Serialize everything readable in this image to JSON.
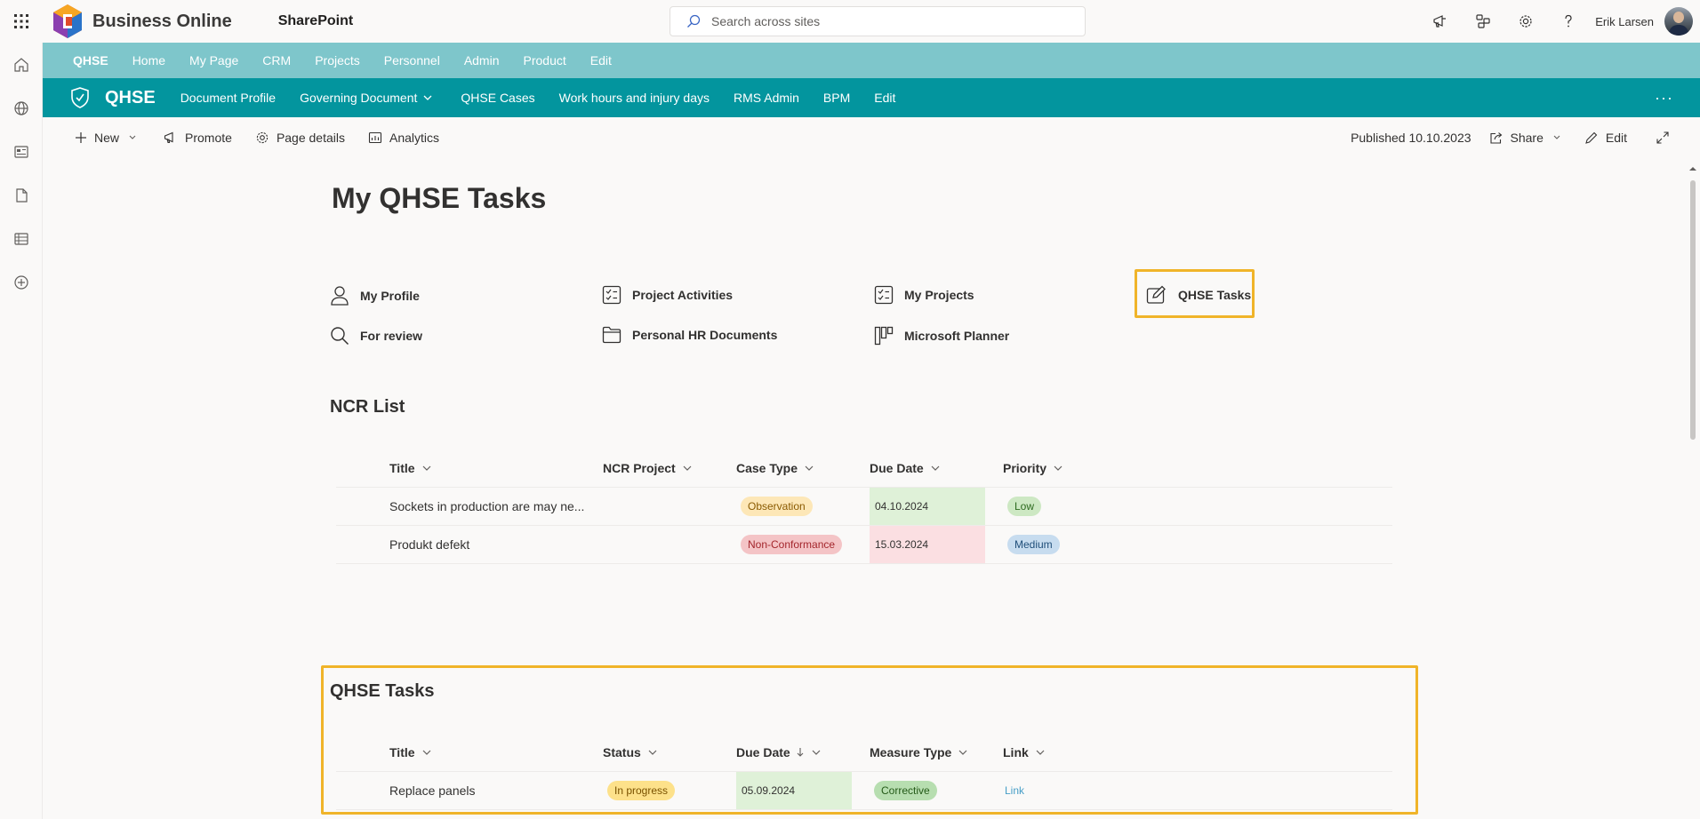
{
  "suite": {
    "brand": "Business Online",
    "app": "SharePoint",
    "search_placeholder": "Search across sites",
    "user": "Erik Larsen",
    "icons": [
      "waffle-icon",
      "megaphone-icon",
      "share-network-icon",
      "gear-icon",
      "help-icon"
    ]
  },
  "hubnav": [
    "QHSE",
    "Home",
    "My Page",
    "CRM",
    "Projects",
    "Personnel",
    "Admin",
    "Product",
    "Edit"
  ],
  "site": {
    "title": "QHSE",
    "nav": [
      "Document Profile",
      "Governing Document",
      "QHSE Cases",
      "Work hours and injury days",
      "RMS Admin",
      "BPM",
      "Edit"
    ]
  },
  "commandbar": {
    "new": "New",
    "promote": "Promote",
    "page_details": "Page details",
    "analytics": "Analytics",
    "published": "Published 10.10.2023",
    "share": "Share",
    "edit": "Edit"
  },
  "page": {
    "title": "My QHSE Tasks"
  },
  "quicklinks": [
    {
      "label": "My Profile",
      "icon": "person-icon"
    },
    {
      "label": "Project Activities",
      "icon": "checklist-icon"
    },
    {
      "label": "My Projects",
      "icon": "checklist-icon"
    },
    {
      "label": "QHSE Tasks",
      "icon": "edit-box-icon"
    },
    {
      "label": "For review",
      "icon": "search-icon"
    },
    {
      "label": "Personal HR Documents",
      "icon": "folder-icon"
    },
    {
      "label": "Microsoft Planner",
      "icon": "planner-icon"
    }
  ],
  "ncr": {
    "title": "NCR List",
    "columns": [
      "Title",
      "NCR Project",
      "Case Type",
      "Due Date",
      "Priority"
    ],
    "rows": [
      {
        "title": "Sockets in production are may ne...",
        "project": "",
        "case_type": "Observation",
        "due": "04.10.2024",
        "priority": "Low"
      },
      {
        "title": "Produkt defekt",
        "project": "",
        "case_type": "Non-Conformance",
        "due": "15.03.2024",
        "priority": "Medium"
      }
    ]
  },
  "tasks": {
    "title": "QHSE Tasks",
    "columns": [
      "Title",
      "Status",
      "Due Date",
      "Measure Type",
      "Link"
    ],
    "rows": [
      {
        "title": "Replace panels",
        "status": "In progress",
        "due": "05.09.2024",
        "measure": "Corrective",
        "link": "Link"
      }
    ]
  },
  "colors": {
    "hub_bar": "#7ec6cb",
    "site_header": "#03959e",
    "highlight": "#f0b429",
    "pill_observation": "#fde7b7",
    "pill_nonconformance": "#f4c4c6",
    "pill_low": "#cde8c3",
    "pill_medium": "#c7dcef",
    "pill_inprogress": "#fde18a",
    "pill_corrective": "#b7deb0",
    "date_ok": "#dff1d8",
    "date_overdue": "#fbdfe2"
  }
}
